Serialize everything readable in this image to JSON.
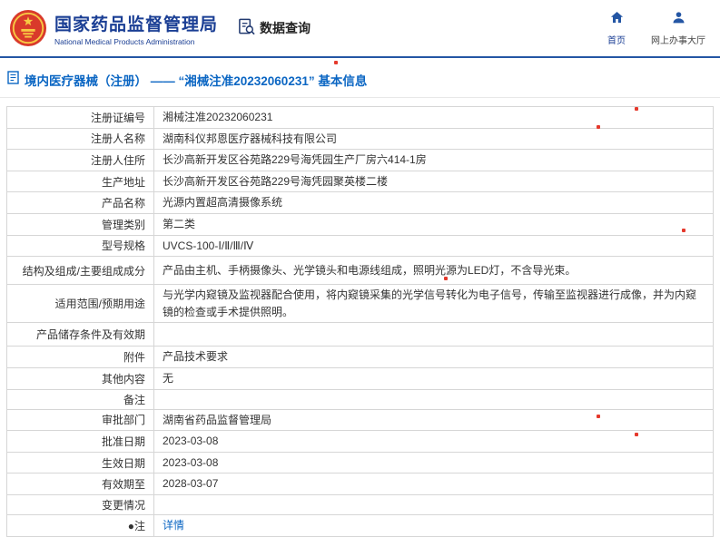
{
  "header": {
    "agency_cn": "国家药品监督管理局",
    "agency_en": "National Medical Products Administration",
    "data_query": "数据查询",
    "nav": [
      {
        "label": "首页"
      },
      {
        "label": "网上办事大厅"
      }
    ]
  },
  "section": {
    "title": "境内医疗器械（注册） —— “湘械注准20232060231” 基本信息"
  },
  "colors": {
    "brand_blue": "#1a3e94",
    "link_blue": "#0b66c3",
    "divider_blue": "#2456a4",
    "emblem_red": "#d93a2b",
    "emblem_gold": "#f7c843"
  },
  "table": {
    "rows": [
      {
        "label": "注册证编号",
        "value": "湘械注准20232060231"
      },
      {
        "label": "注册人名称",
        "value": "湖南科仪邦恩医疗器械科技有限公司"
      },
      {
        "label": "注册人住所",
        "value": "长沙高新开发区谷苑路229号海凭园生产厂房六414-1房"
      },
      {
        "label": "生产地址",
        "value": "长沙高新开发区谷苑路229号海凭园聚英楼二楼"
      },
      {
        "label": "产品名称",
        "value": "光源内置超高清摄像系统"
      },
      {
        "label": "管理类别",
        "value": "第二类"
      },
      {
        "label": "型号规格",
        "value": "UVCS-100-Ⅰ/Ⅱ/Ⅲ/Ⅳ"
      },
      {
        "label": "结构及组成/主要组成成分",
        "value": "产品由主机、手柄摄像头、光学镜头和电源线组成，照明光源为LED灯，不含导光束。"
      },
      {
        "label": "适用范围/预期用途",
        "value": "与光学内窥镜及监视器配合使用，将内窥镜采集的光学信号转化为电子信号，传输至监视器进行成像，并为内窥镜的检查或手术提供照明。"
      },
      {
        "label": "产品储存条件及有效期",
        "value": ""
      },
      {
        "label": "附件",
        "value": "产品技术要求"
      },
      {
        "label": "其他内容",
        "value": "无"
      },
      {
        "label": "备注",
        "value": ""
      },
      {
        "label": "审批部门",
        "value": "湖南省药品监督管理局"
      },
      {
        "label": "批准日期",
        "value": "2023-03-08"
      },
      {
        "label": "生效日期",
        "value": "2023-03-08"
      },
      {
        "label": "有效期至",
        "value": "2028-03-07"
      },
      {
        "label": "变更情况",
        "value": ""
      },
      {
        "label": "●注",
        "value": "详情",
        "link": true
      }
    ]
  }
}
